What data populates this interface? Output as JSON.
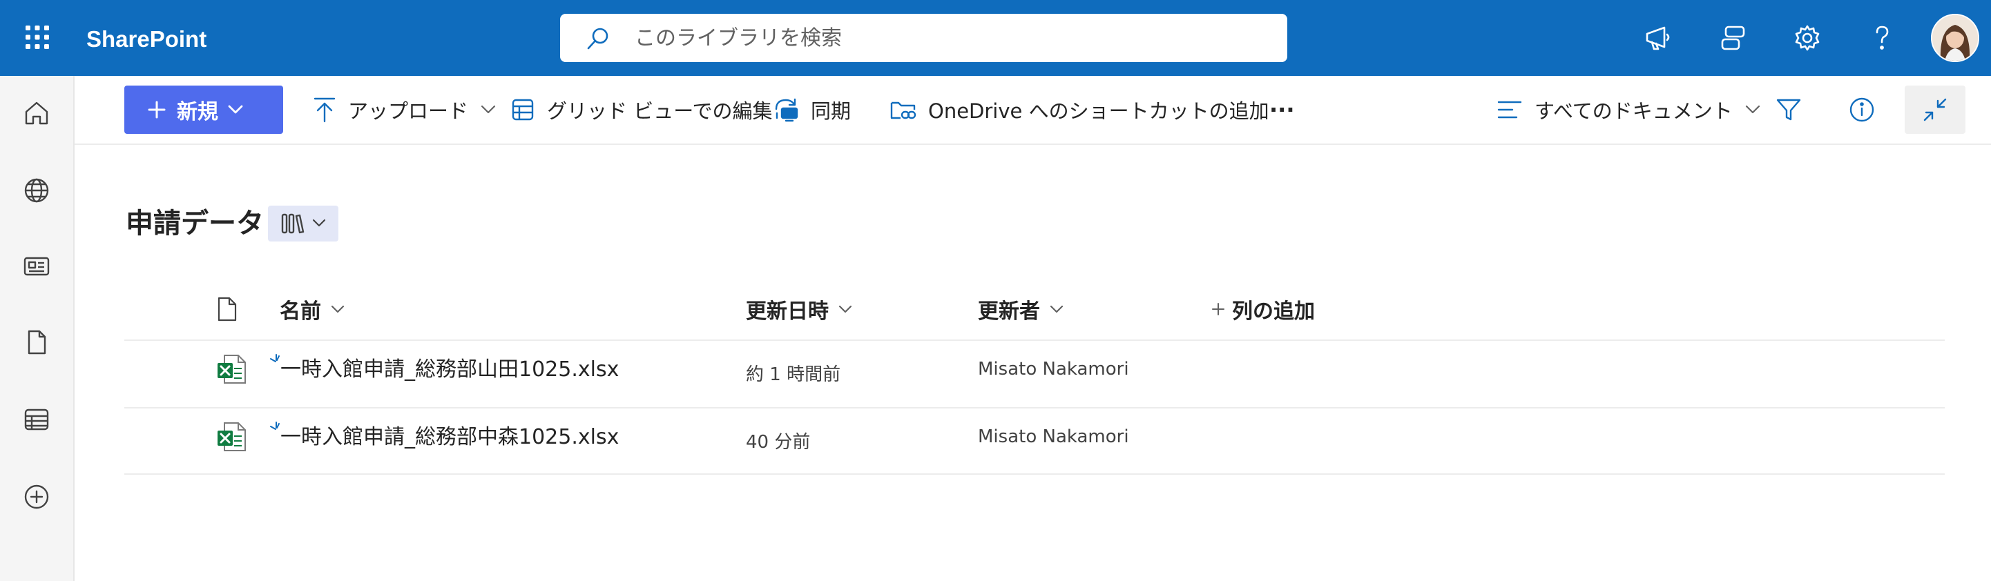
{
  "app": {
    "name": "SharePoint"
  },
  "search": {
    "placeholder": "このライブラリを検索"
  },
  "commandbar": {
    "new_label": "新規",
    "upload_label": "アップロード",
    "grid_edit_label": "グリッド ビューでの編集",
    "sync_label": "同期",
    "shortcut_label": "OneDrive へのショートカットの追加",
    "more_label": "···",
    "view_label": "すべてのドキュメント"
  },
  "library": {
    "title": "申請データ"
  },
  "columns": {
    "name": "名前",
    "modified": "更新日時",
    "modified_by": "更新者",
    "add_column": "列の追加"
  },
  "files": [
    {
      "name": "一時入館申請_総務部山田1025.xlsx",
      "modified": "約 1 時間前",
      "modified_by": "Misato Nakamori",
      "type": "excel",
      "is_new": true
    },
    {
      "name": "一時入館申請_総務部中森1025.xlsx",
      "modified": "40 分前",
      "modified_by": "Misato Nakamori",
      "type": "excel",
      "is_new": true
    }
  ],
  "colors": {
    "suitebar": "#0f6cbd",
    "new_button": "#4f6bed",
    "accent": "#0f6cbd",
    "excel": "#107c41"
  }
}
